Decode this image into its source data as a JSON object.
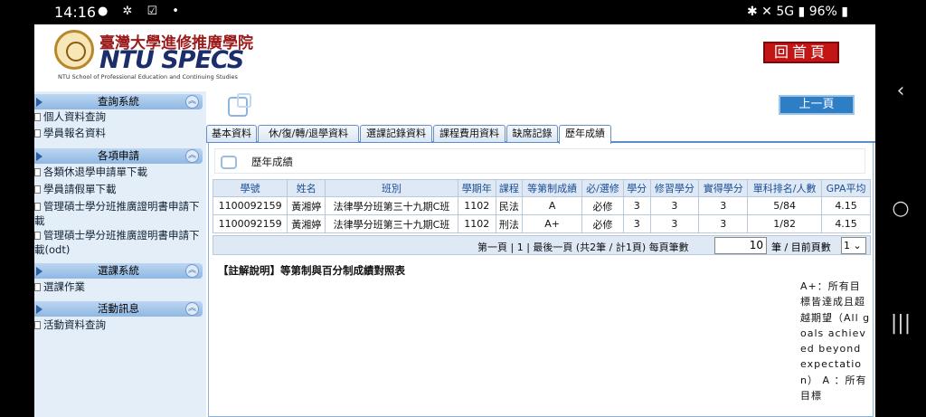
{
  "status_bar": {
    "time": "14:16",
    "battery": "96%",
    "network": "5G"
  },
  "header": {
    "logo_cn": "臺灣大學進修推廣學院",
    "logo_en": "NTU SPECS",
    "logo_sub": "NTU School of Professional Education and Continuing Studies",
    "home_button": "回首頁"
  },
  "sidebar": {
    "sections": [
      {
        "title": "查詢系統",
        "items": [
          "個人資料查詢",
          "學員報名資料"
        ]
      },
      {
        "title": "各項申請",
        "items": [
          "各類休退學申請單下載",
          "學員請假單下載",
          "管理碩士學分班推廣證明書申請下載",
          "管理碩士學分班推廣證明書申請下載(odt)"
        ]
      },
      {
        "title": "選課系統",
        "items": [
          "選課作業"
        ]
      },
      {
        "title": "活動訊息",
        "items": [
          "活動資料查詢"
        ]
      }
    ]
  },
  "main": {
    "prev_button": "上一頁",
    "tabs": [
      {
        "label": "基本資料"
      },
      {
        "label": "休/復/轉/退學資料"
      },
      {
        "label": "選課記錄資料"
      },
      {
        "label": "課程費用資料"
      },
      {
        "label": "缺席記錄"
      },
      {
        "label": "歷年成績",
        "active": true
      }
    ],
    "panel_title": "歷年成績",
    "table": {
      "headers": [
        "學號",
        "姓名",
        "班別",
        "學期年",
        "課程",
        "等第制成績",
        "必/選修",
        "學分",
        "修習學分",
        "實得學分",
        "單科排名/人數",
        "GPA平均"
      ],
      "rows": [
        [
          "1100092159",
          "黃湘婷",
          "法律學分班第三十九期C班",
          "1102",
          "民法",
          "A",
          "必修",
          "3",
          "3",
          "3",
          "5/84",
          "4.15"
        ],
        [
          "1100092159",
          "黃湘婷",
          "法律學分班第三十九期C班",
          "1102",
          "刑法",
          "A+",
          "必修",
          "3",
          "3",
          "3",
          "1/82",
          "4.15"
        ]
      ]
    },
    "pager": {
      "text": "第一頁 | 1 | 最後一頁 (共2筆 / 計1頁) 每頁筆數",
      "page_size": "10",
      "text2": "筆 /  目前頁數",
      "current_page": "1"
    },
    "note_title": "【註解說明】等第制與百分制成績對照表",
    "note_text": "A+：所有目標皆達成且超越期望（All goals achieved beyond expectation） A ：所有目標"
  }
}
